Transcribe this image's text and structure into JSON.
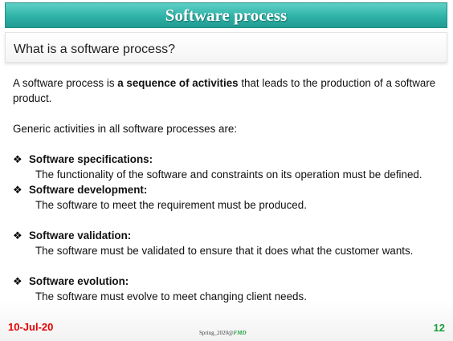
{
  "title": "Software process",
  "subtitle": "What is a software process?",
  "intro": {
    "before": "A software process is ",
    "bold": "a sequence of activities",
    "after": " that leads to the production of a software product."
  },
  "generic_line": "Generic activities in all software processes are:",
  "bullets": [
    {
      "head": "Software specifications:",
      "desc": "The functionality of the software and constraints on its operation must be defined."
    },
    {
      "head": "Software development:",
      "desc": "The software to meet the requirement must be produced."
    },
    {
      "head": "Software validation:",
      "desc": "The software must be validated to ensure that it does what the customer wants."
    },
    {
      "head": "Software evolution:",
      "desc": "The software must evolve to meet changing client needs."
    }
  ],
  "bullet_glyph": "❖",
  "footer": {
    "date": "10-Jul-20",
    "center_prefix": "Spring_2020@",
    "center_brand": "FMD",
    "page": "12"
  },
  "colors": {
    "title_bar": "#2fb2a7",
    "date": "#e60000",
    "page_number": "#1a9e3a"
  }
}
